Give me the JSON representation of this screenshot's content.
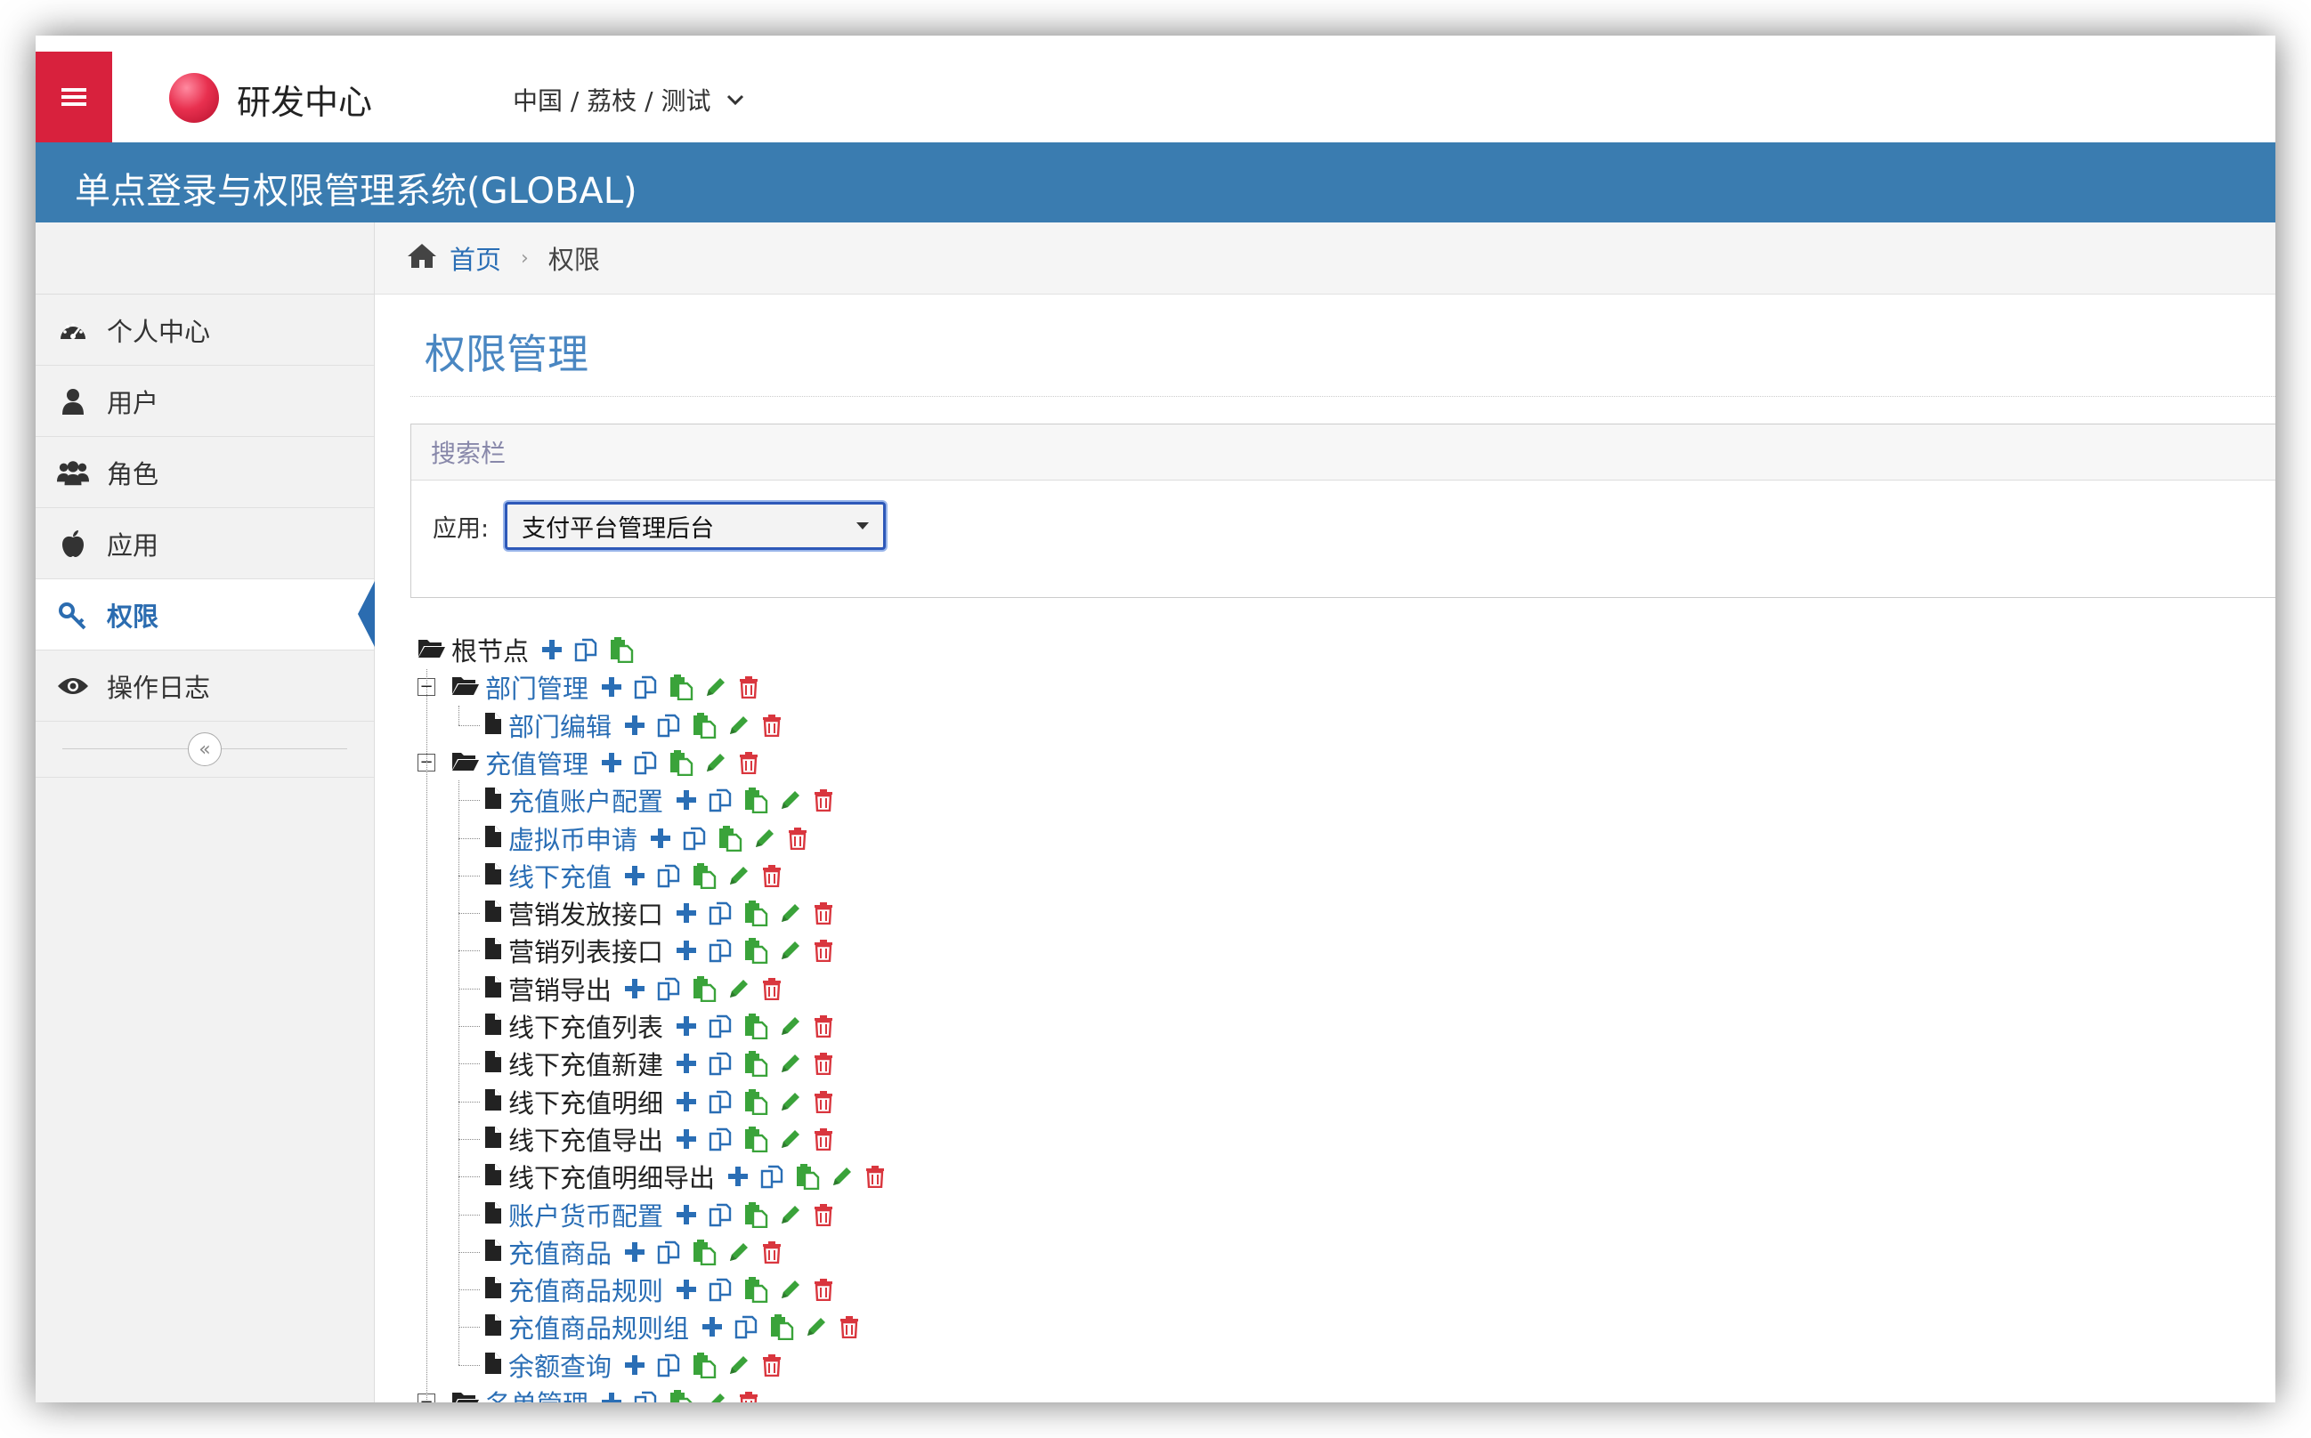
{
  "header": {
    "menu_icon": "hamburger-icon",
    "app_name": "研发中心",
    "org_path": "中国 / 荔枝 / 测试",
    "system_title": "单点登录与权限管理系统(GLOBAL)",
    "colors": {
      "brand_red": "#d8213d",
      "header_blue": "#3a7cb0",
      "link_blue": "#2a6eb5",
      "add_blue": "#2a6eb5",
      "green": "#3aa33a",
      "delete_red": "#d9363e"
    }
  },
  "sidebar": {
    "items": [
      {
        "label": "个人中心",
        "icon": "dashboard-icon"
      },
      {
        "label": "用户",
        "icon": "user-icon"
      },
      {
        "label": "角色",
        "icon": "users-icon"
      },
      {
        "label": "应用",
        "icon": "apple-icon"
      },
      {
        "label": "权限",
        "icon": "key-icon",
        "active": true
      },
      {
        "label": "操作日志",
        "icon": "eye-icon"
      }
    ],
    "collapse_icon": "double-chevron-left-icon"
  },
  "breadcrumb": {
    "home": "首页",
    "current": "权限"
  },
  "page": {
    "title": "权限管理"
  },
  "search": {
    "header": "搜索栏",
    "app_label": "应用:",
    "app_selected": "支付平台管理后台"
  },
  "tree": {
    "root": {
      "label": "根节点"
    },
    "groups": [
      {
        "label": "部门管理",
        "children": [
          {
            "label": "部门编辑",
            "link": true
          }
        ]
      },
      {
        "label": "充值管理",
        "children": [
          {
            "label": "充值账户配置",
            "link": true
          },
          {
            "label": "虚拟币申请",
            "link": true
          },
          {
            "label": "线下充值",
            "link": true
          },
          {
            "label": "营销发放接口",
            "link": false
          },
          {
            "label": "营销列表接口",
            "link": false
          },
          {
            "label": "营销导出",
            "link": false
          },
          {
            "label": "线下充值列表",
            "link": false
          },
          {
            "label": "线下充值新建",
            "link": false
          },
          {
            "label": "线下充值明细",
            "link": false
          },
          {
            "label": "线下充值导出",
            "link": false
          },
          {
            "label": "线下充值明细导出",
            "link": false
          },
          {
            "label": "账户货币配置",
            "link": true
          },
          {
            "label": "充值商品",
            "link": true
          },
          {
            "label": "充值商品规则",
            "link": true
          },
          {
            "label": "充值商品规则组",
            "link": true
          },
          {
            "label": "余额查询",
            "link": true
          }
        ]
      },
      {
        "label": "名单管理",
        "children": []
      }
    ]
  }
}
